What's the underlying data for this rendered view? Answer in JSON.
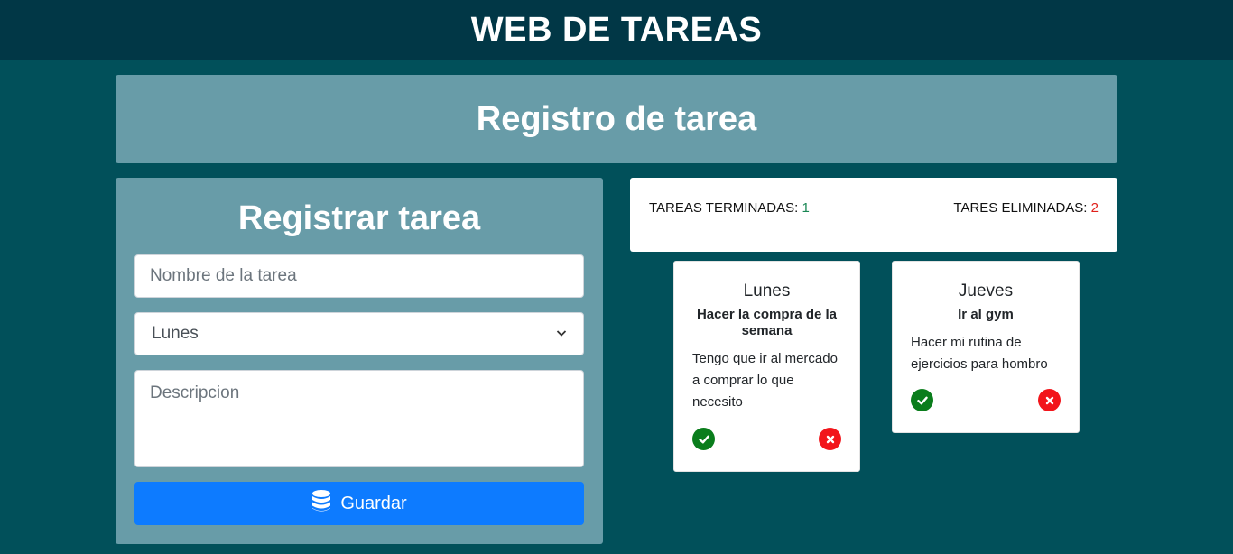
{
  "header": {
    "title": "WEB DE TAREAS"
  },
  "banner": {
    "title": "Registro de tarea"
  },
  "form": {
    "title": "Registrar tarea",
    "name_placeholder": "Nombre de la tarea",
    "day_selected": "Lunes",
    "description_placeholder": "Descripcion",
    "save_label": "Guardar"
  },
  "stats": {
    "finished_label": "TAREAS TERMINADAS:",
    "finished_count": "1",
    "deleted_label": "TARES ELIMINADAS:",
    "deleted_count": "2"
  },
  "tasks": [
    {
      "day": "Lunes",
      "title": "Hacer la compra de la semana",
      "description": "Tengo que ir al mercado a comprar lo que necesito"
    },
    {
      "day": "Jueves",
      "title": "Ir al gym",
      "description": "Hacer mi rutina de ejercicios para hombro"
    }
  ],
  "icons": {
    "save": "database-icon",
    "complete": "check-circle-icon",
    "delete": "x-circle-icon"
  },
  "colors": {
    "page_bg": "#01505a",
    "topbar_bg": "#013746",
    "panel_bg": "#689ca8",
    "primary": "#0d7bff",
    "success": "#0a7d1c",
    "danger": "#f2151b"
  }
}
